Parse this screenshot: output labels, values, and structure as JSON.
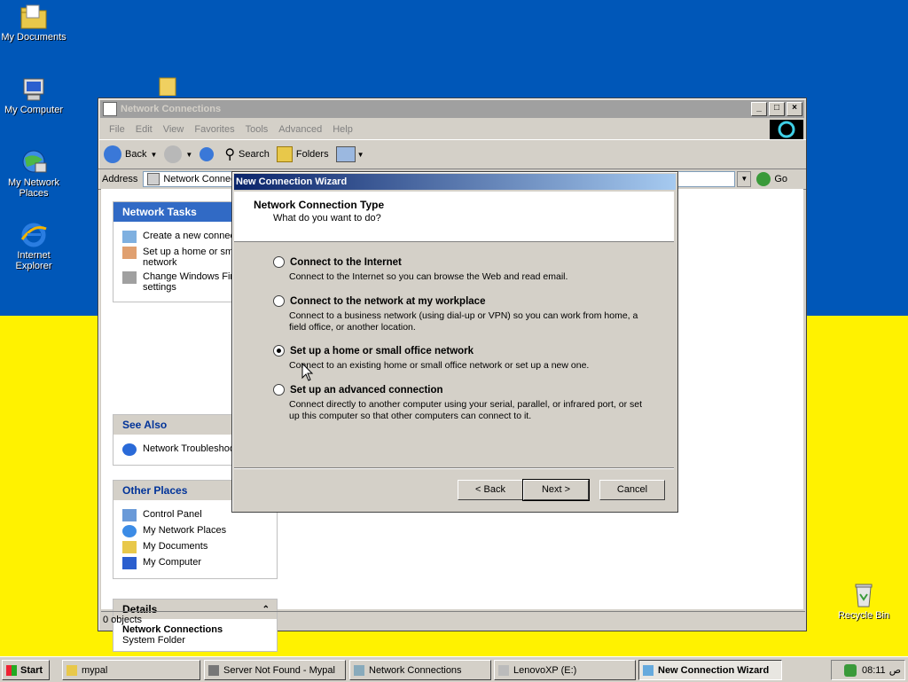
{
  "desktop": {
    "icons": [
      {
        "label": "My Documents"
      },
      {
        "label": "My Computer"
      },
      {
        "label": "My Network Places"
      },
      {
        "label": "Internet Explorer"
      },
      {
        "label": "Recycle Bin"
      }
    ]
  },
  "window": {
    "title": "Network Connections",
    "menu": [
      "File",
      "Edit",
      "View",
      "Favorites",
      "Tools",
      "Advanced",
      "Help"
    ],
    "toolbar": {
      "back": "Back",
      "search": "Search",
      "folders": "Folders"
    },
    "address": {
      "label": "Address",
      "value": "Network Connections",
      "go": "Go"
    },
    "status": "0 objects"
  },
  "sidebar": {
    "network_tasks": {
      "title": "Network Tasks",
      "items": [
        "Create a new connection",
        "Set up a home or small office network",
        "Change Windows Firewall settings"
      ]
    },
    "see_also": {
      "title": "See Also",
      "items": [
        "Network Troubleshooter"
      ]
    },
    "other_places": {
      "title": "Other Places",
      "items": [
        "Control Panel",
        "My Network Places",
        "My Documents",
        "My Computer"
      ]
    },
    "details": {
      "title": "Details",
      "name": "Network Connections",
      "type": "System Folder"
    }
  },
  "wizard": {
    "title": "New Connection Wizard",
    "header": {
      "title": "Network Connection Type",
      "subtitle": "What do you want to do?"
    },
    "options": [
      {
        "label": "Connect to the Internet",
        "desc": "Connect to the Internet so you can browse the Web and read email.",
        "selected": false
      },
      {
        "label": "Connect to the network at my workplace",
        "desc": "Connect to a business network (using dial-up or VPN) so you can work from home, a field office, or another location.",
        "selected": false
      },
      {
        "label": "Set up a home or small office network",
        "desc": "Connect to an existing home or small office network or set up a new one.",
        "selected": true
      },
      {
        "label": "Set up an advanced connection",
        "desc": "Connect directly to another computer using your serial, parallel, or infrared port, or set up this computer so that other computers can connect to it.",
        "selected": false
      }
    ],
    "buttons": {
      "back": "< Back",
      "next": "Next >",
      "cancel": "Cancel"
    }
  },
  "taskbar": {
    "start": "Start",
    "tasks": [
      "mypal",
      "Server Not Found - Mypal",
      "Network Connections",
      "LenovoXP (E:)",
      "New Connection Wizard"
    ],
    "clock": "08:11",
    "ampm": "ص"
  }
}
